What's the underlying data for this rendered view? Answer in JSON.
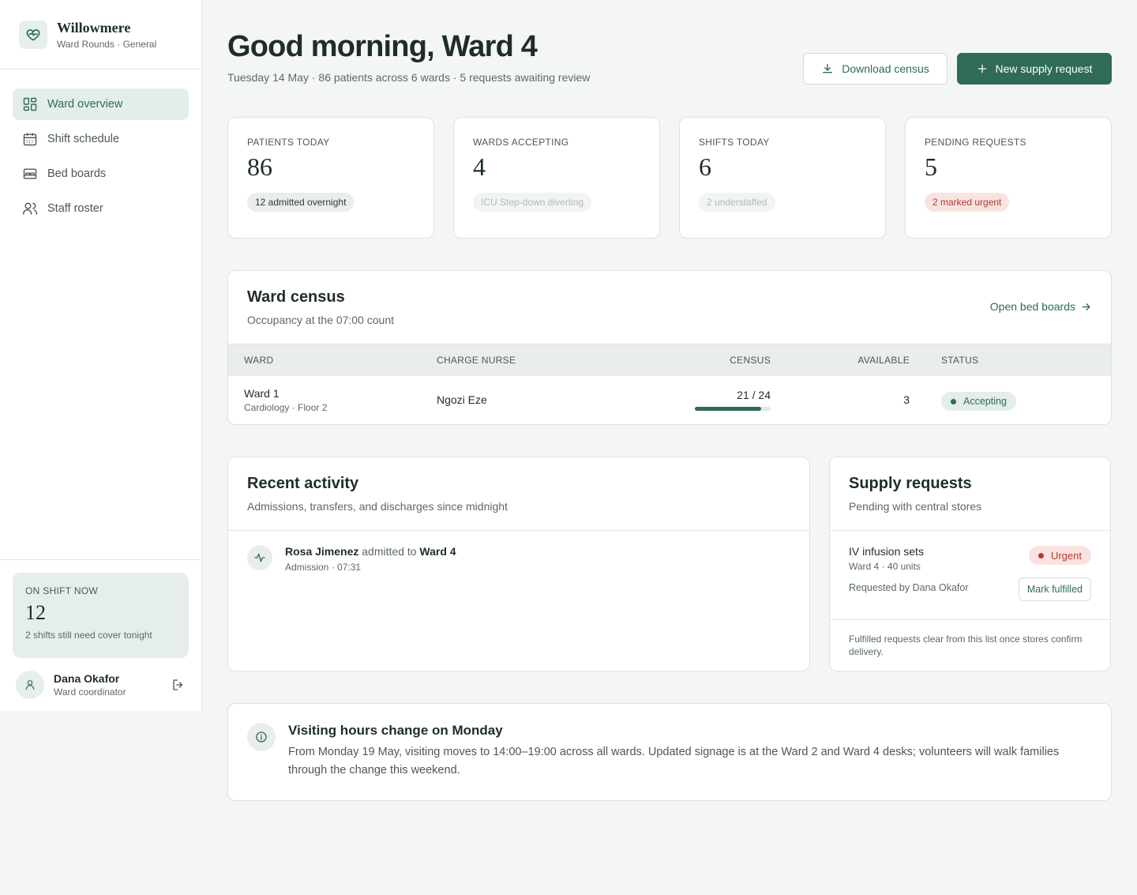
{
  "brand": {
    "name": "Willowmere",
    "subtitle": "Ward Rounds · General"
  },
  "nav": {
    "items": [
      {
        "label": "Ward overview",
        "icon": "grid-icon",
        "active": true
      },
      {
        "label": "Shift schedule",
        "icon": "calendar-icon"
      },
      {
        "label": "Bed boards",
        "icon": "bed-icon"
      },
      {
        "label": "Staff roster",
        "icon": "people-icon"
      }
    ]
  },
  "on_shift": {
    "label": "ON SHIFT NOW",
    "count": "12",
    "note": "2 shifts still need cover tonight"
  },
  "user": {
    "name": "Dana Okafor",
    "role": "Ward coordinator"
  },
  "header": {
    "greeting": "Good morning, Ward 4",
    "subline": "Tuesday 14 May · 86 patients across 6 wards · 5 requests awaiting review",
    "download_label": "Download census",
    "new_request_label": "New supply request"
  },
  "stats": [
    {
      "label": "PATIENTS TODAY",
      "value": "86",
      "badge": "12 admitted overnight",
      "badge_style": "neutral"
    },
    {
      "label": "WARDS ACCEPTING",
      "value": "4",
      "badge": "ICU Step-down diverting",
      "badge_style": "faded"
    },
    {
      "label": "SHIFTS TODAY",
      "value": "6",
      "badge": "2 understaffed",
      "badge_style": "faded"
    },
    {
      "label": "PENDING REQUESTS",
      "value": "5",
      "badge": "2 marked urgent",
      "badge_style": "red"
    }
  ],
  "census": {
    "title": "Ward census",
    "subtitle": "Occupancy at the 07:00 count",
    "link_label": "Open bed boards",
    "columns": {
      "ward": "WARD",
      "nurse": "CHARGE NURSE",
      "census": "CENSUS",
      "available": "AVAILABLE",
      "status": "STATUS"
    },
    "rows": [
      {
        "ward": "Ward 1",
        "meta": "Cardiology · Floor 2",
        "nurse": "Ngozi Eze",
        "census_text": "21 / 24",
        "occupied": 21,
        "capacity": 24,
        "available": "3",
        "status": "Accepting"
      }
    ]
  },
  "activity": {
    "title": "Recent activity",
    "subtitle": "Admissions, transfers, and discharges since midnight",
    "items": [
      {
        "patient": "Rosa Jimenez",
        "action": "admitted to",
        "ward": "Ward 4",
        "meta": "Admission · 07:31"
      }
    ]
  },
  "supply": {
    "title": "Supply requests",
    "subtitle": "Pending with central stores",
    "requests": [
      {
        "name": "IV infusion sets",
        "meta": "Ward 4 · 40 units",
        "priority": "Urgent",
        "requested_by": "Requested by Dana Okafor",
        "action": "Mark fulfilled"
      }
    ],
    "footer": "Fulfilled requests clear from this list once stores confirm delivery."
  },
  "notice": {
    "title": "Visiting hours change on Monday",
    "body": "From Monday 19 May, visiting moves to 14:00–19:00 across all wards. Updated signage is at the Ward 2 and Ward 4 desks; volunteers will walk families through the change this weekend."
  },
  "colors": {
    "accent": "#2f6b55",
    "accent_soft": "#e3eee8",
    "urgent": "#b43a31",
    "urgent_soft": "#f9e3e1",
    "page_bg": "#f4f6f4"
  }
}
